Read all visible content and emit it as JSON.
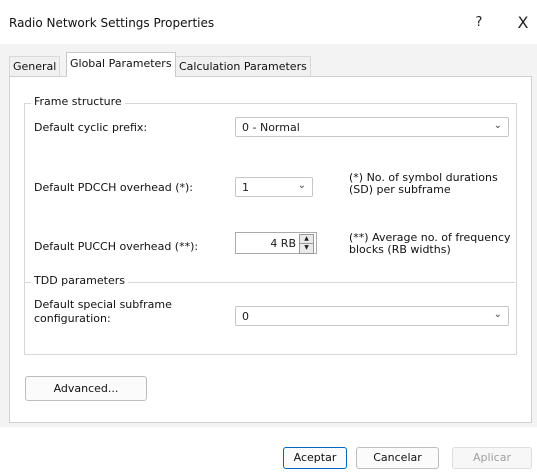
{
  "window": {
    "title": "Radio Network Settings Properties",
    "help_label": "?",
    "close_label": "X"
  },
  "tabs": [
    {
      "label": "General",
      "active": false
    },
    {
      "label": "Global Parameters",
      "active": true
    },
    {
      "label": "Calculation Parameters",
      "active": false
    }
  ],
  "frame_structure": {
    "legend": "Frame structure",
    "cyclic_prefix": {
      "label": "Default cyclic prefix:",
      "value": "0 - Normal"
    },
    "pdcch": {
      "label": "Default PDCCH overhead (*):",
      "value": "1",
      "note_line1": "(*) No. of symbol durations",
      "note_line2": "(SD) per subframe"
    },
    "pucch": {
      "label": "Default PUCCH overhead (**):",
      "value": "4 RB",
      "note_line1": "(**) Average no. of frequency",
      "note_line2": "blocks (RB widths)"
    }
  },
  "tdd": {
    "legend": "TDD parameters",
    "special_subframe": {
      "label_line1": "Default special subframe",
      "label_line2": "configuration:",
      "value": "0"
    }
  },
  "buttons": {
    "advanced": "Advanced...",
    "accept": "Aceptar",
    "cancel": "Cancelar",
    "apply": "Aplicar"
  },
  "colors": {
    "accent": "#0067c0",
    "panel_bg": "#ffffff",
    "dialog_bg": "#f3f3f3"
  }
}
